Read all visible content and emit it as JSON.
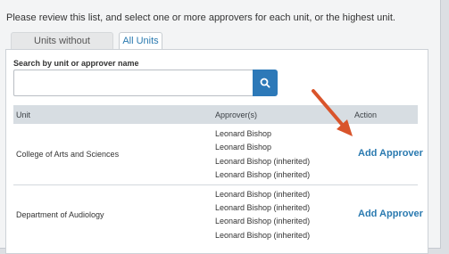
{
  "instructions": "Please review this list, and select one or more approvers for each unit, or the highest unit.",
  "tabs": [
    {
      "label": "Units without Approvers",
      "active": false
    },
    {
      "label": "All Units",
      "active": true
    }
  ],
  "search": {
    "label": "Search by unit or approver name",
    "value": "",
    "placeholder": "",
    "button_icon": "search-icon"
  },
  "table": {
    "headers": [
      "Unit",
      "Approver(s)",
      "Action"
    ],
    "rows": [
      {
        "unit": "College of Arts and Sciences",
        "approvers": [
          "Leonard Bishop",
          "Leonard Bishop",
          "Leonard Bishop (inherited)",
          "Leonard Bishop (inherited)"
        ],
        "action": "Add Approver"
      },
      {
        "unit": "Department of Audiology",
        "approvers": [
          "Leonard Bishop (inherited)",
          "Leonard Bishop (inherited)",
          "Leonard Bishop (inherited)",
          "Leonard Bishop (inherited)"
        ],
        "action": "Add Approver"
      }
    ]
  },
  "colors": {
    "accent": "#2a7ab0",
    "annotation_arrow": "#d9542b",
    "header_bg": "#d7dde2"
  }
}
